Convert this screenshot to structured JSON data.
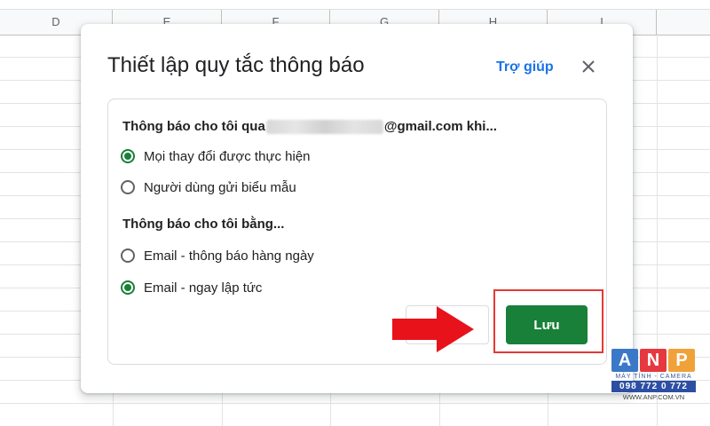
{
  "sheet": {
    "columns": [
      "D",
      "E",
      "F",
      "G",
      "H",
      "I"
    ]
  },
  "dialog": {
    "title": "Thiết lập quy tắc thông báo",
    "help_label": "Trợ giúp",
    "close_icon": "close-icon",
    "notify_via": {
      "prefix": "Thông báo cho tôi qua",
      "suffix": "@gmail.com khi..."
    },
    "trigger_options": [
      {
        "label": "Mọi thay đổi được thực hiện",
        "checked": true
      },
      {
        "label": "Người dùng gửi biểu mẫu",
        "checked": false
      }
    ],
    "method_title": "Thông báo cho tôi bằng...",
    "method_options": [
      {
        "label": "Email - thông báo hàng ngày",
        "checked": false
      },
      {
        "label": "Email - ngay lập tức",
        "checked": true
      }
    ],
    "save_label": "Lưu"
  },
  "annotation": {
    "arrow_color": "#e8121b",
    "highlight_color": "#e53935"
  },
  "watermark": {
    "letters": [
      "A",
      "N",
      "P"
    ],
    "tagline": "MÁY TÍNH - CAMERA",
    "phone": "098 772 0 772",
    "url": "WWW.ANP.COM.VN"
  },
  "colors": {
    "accent_green": "#188038",
    "link_blue": "#1a73e8"
  }
}
